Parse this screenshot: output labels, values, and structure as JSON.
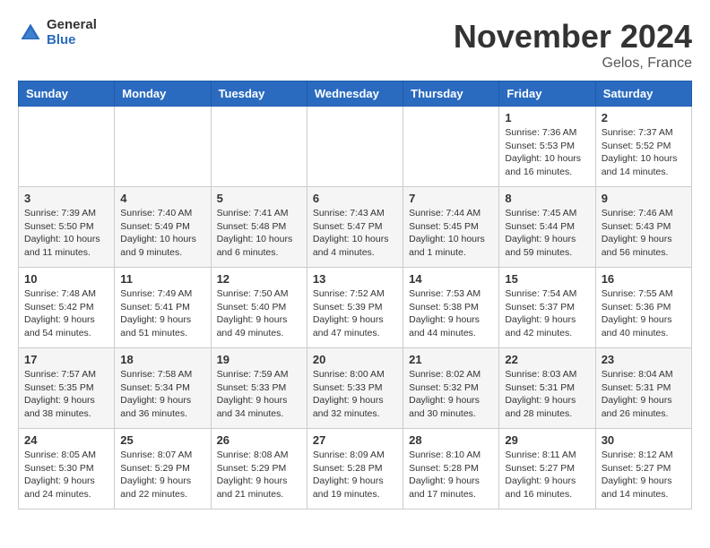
{
  "header": {
    "logo_general": "General",
    "logo_blue": "Blue",
    "month_title": "November 2024",
    "location": "Gelos, France"
  },
  "weekdays": [
    "Sunday",
    "Monday",
    "Tuesday",
    "Wednesday",
    "Thursday",
    "Friday",
    "Saturday"
  ],
  "weeks": [
    [
      {
        "day": "",
        "info": ""
      },
      {
        "day": "",
        "info": ""
      },
      {
        "day": "",
        "info": ""
      },
      {
        "day": "",
        "info": ""
      },
      {
        "day": "",
        "info": ""
      },
      {
        "day": "1",
        "info": "Sunrise: 7:36 AM\nSunset: 5:53 PM\nDaylight: 10 hours and 16 minutes."
      },
      {
        "day": "2",
        "info": "Sunrise: 7:37 AM\nSunset: 5:52 PM\nDaylight: 10 hours and 14 minutes."
      }
    ],
    [
      {
        "day": "3",
        "info": "Sunrise: 7:39 AM\nSunset: 5:50 PM\nDaylight: 10 hours and 11 minutes."
      },
      {
        "day": "4",
        "info": "Sunrise: 7:40 AM\nSunset: 5:49 PM\nDaylight: 10 hours and 9 minutes."
      },
      {
        "day": "5",
        "info": "Sunrise: 7:41 AM\nSunset: 5:48 PM\nDaylight: 10 hours and 6 minutes."
      },
      {
        "day": "6",
        "info": "Sunrise: 7:43 AM\nSunset: 5:47 PM\nDaylight: 10 hours and 4 minutes."
      },
      {
        "day": "7",
        "info": "Sunrise: 7:44 AM\nSunset: 5:45 PM\nDaylight: 10 hours and 1 minute."
      },
      {
        "day": "8",
        "info": "Sunrise: 7:45 AM\nSunset: 5:44 PM\nDaylight: 9 hours and 59 minutes."
      },
      {
        "day": "9",
        "info": "Sunrise: 7:46 AM\nSunset: 5:43 PM\nDaylight: 9 hours and 56 minutes."
      }
    ],
    [
      {
        "day": "10",
        "info": "Sunrise: 7:48 AM\nSunset: 5:42 PM\nDaylight: 9 hours and 54 minutes."
      },
      {
        "day": "11",
        "info": "Sunrise: 7:49 AM\nSunset: 5:41 PM\nDaylight: 9 hours and 51 minutes."
      },
      {
        "day": "12",
        "info": "Sunrise: 7:50 AM\nSunset: 5:40 PM\nDaylight: 9 hours and 49 minutes."
      },
      {
        "day": "13",
        "info": "Sunrise: 7:52 AM\nSunset: 5:39 PM\nDaylight: 9 hours and 47 minutes."
      },
      {
        "day": "14",
        "info": "Sunrise: 7:53 AM\nSunset: 5:38 PM\nDaylight: 9 hours and 44 minutes."
      },
      {
        "day": "15",
        "info": "Sunrise: 7:54 AM\nSunset: 5:37 PM\nDaylight: 9 hours and 42 minutes."
      },
      {
        "day": "16",
        "info": "Sunrise: 7:55 AM\nSunset: 5:36 PM\nDaylight: 9 hours and 40 minutes."
      }
    ],
    [
      {
        "day": "17",
        "info": "Sunrise: 7:57 AM\nSunset: 5:35 PM\nDaylight: 9 hours and 38 minutes."
      },
      {
        "day": "18",
        "info": "Sunrise: 7:58 AM\nSunset: 5:34 PM\nDaylight: 9 hours and 36 minutes."
      },
      {
        "day": "19",
        "info": "Sunrise: 7:59 AM\nSunset: 5:33 PM\nDaylight: 9 hours and 34 minutes."
      },
      {
        "day": "20",
        "info": "Sunrise: 8:00 AM\nSunset: 5:33 PM\nDaylight: 9 hours and 32 minutes."
      },
      {
        "day": "21",
        "info": "Sunrise: 8:02 AM\nSunset: 5:32 PM\nDaylight: 9 hours and 30 minutes."
      },
      {
        "day": "22",
        "info": "Sunrise: 8:03 AM\nSunset: 5:31 PM\nDaylight: 9 hours and 28 minutes."
      },
      {
        "day": "23",
        "info": "Sunrise: 8:04 AM\nSunset: 5:31 PM\nDaylight: 9 hours and 26 minutes."
      }
    ],
    [
      {
        "day": "24",
        "info": "Sunrise: 8:05 AM\nSunset: 5:30 PM\nDaylight: 9 hours and 24 minutes."
      },
      {
        "day": "25",
        "info": "Sunrise: 8:07 AM\nSunset: 5:29 PM\nDaylight: 9 hours and 22 minutes."
      },
      {
        "day": "26",
        "info": "Sunrise: 8:08 AM\nSunset: 5:29 PM\nDaylight: 9 hours and 21 minutes."
      },
      {
        "day": "27",
        "info": "Sunrise: 8:09 AM\nSunset: 5:28 PM\nDaylight: 9 hours and 19 minutes."
      },
      {
        "day": "28",
        "info": "Sunrise: 8:10 AM\nSunset: 5:28 PM\nDaylight: 9 hours and 17 minutes."
      },
      {
        "day": "29",
        "info": "Sunrise: 8:11 AM\nSunset: 5:27 PM\nDaylight: 9 hours and 16 minutes."
      },
      {
        "day": "30",
        "info": "Sunrise: 8:12 AM\nSunset: 5:27 PM\nDaylight: 9 hours and 14 minutes."
      }
    ]
  ]
}
